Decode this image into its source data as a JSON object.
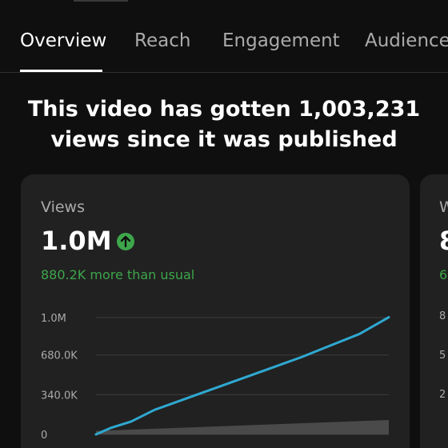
{
  "tabs": [
    {
      "label": "Overview",
      "active": true
    },
    {
      "label": "Reach",
      "active": false
    },
    {
      "label": "Engagement",
      "active": false
    },
    {
      "label": "Audience",
      "active": false
    }
  ],
  "headline": {
    "line1": "This video has gotten 1,003,231",
    "line2": "views since it was published"
  },
  "views_card": {
    "label": "Views",
    "value": "1.0M",
    "trend_icon": "arrow-up-circle-icon",
    "delta": "880.2K more than usual"
  },
  "second_card": {
    "label": "W",
    "value": "8",
    "delta": "6",
    "ticks": [
      "8",
      "5",
      "2"
    ]
  },
  "colors": {
    "background": "#0f0f0f",
    "card": "#212121",
    "positive": "#3ea64b",
    "line": "#2fa8d0",
    "typical_band": "#4a4a4a"
  },
  "chart_data": {
    "type": "line",
    "ylabels": [
      "1.0M",
      "680.0K",
      "340.0K",
      "0"
    ],
    "yticks": [
      1000000,
      680000,
      340000,
      0
    ],
    "ylim": [
      0,
      1000000
    ],
    "x": [
      0,
      0.05,
      0.12,
      0.2,
      0.3,
      0.4,
      0.5,
      0.6,
      0.7,
      0.8,
      0.9,
      1.0
    ],
    "series": [
      {
        "values": [
          0,
          55000,
          110000,
          210000,
          300000,
          390000,
          480000,
          570000,
          660000,
          760000,
          860000,
          1003231
        ]
      }
    ],
    "typical_band": {
      "x": [
        0,
        1.0
      ],
      "low": [
        0,
        0
      ],
      "high": [
        30000,
        123000
      ]
    },
    "grid": true
  }
}
